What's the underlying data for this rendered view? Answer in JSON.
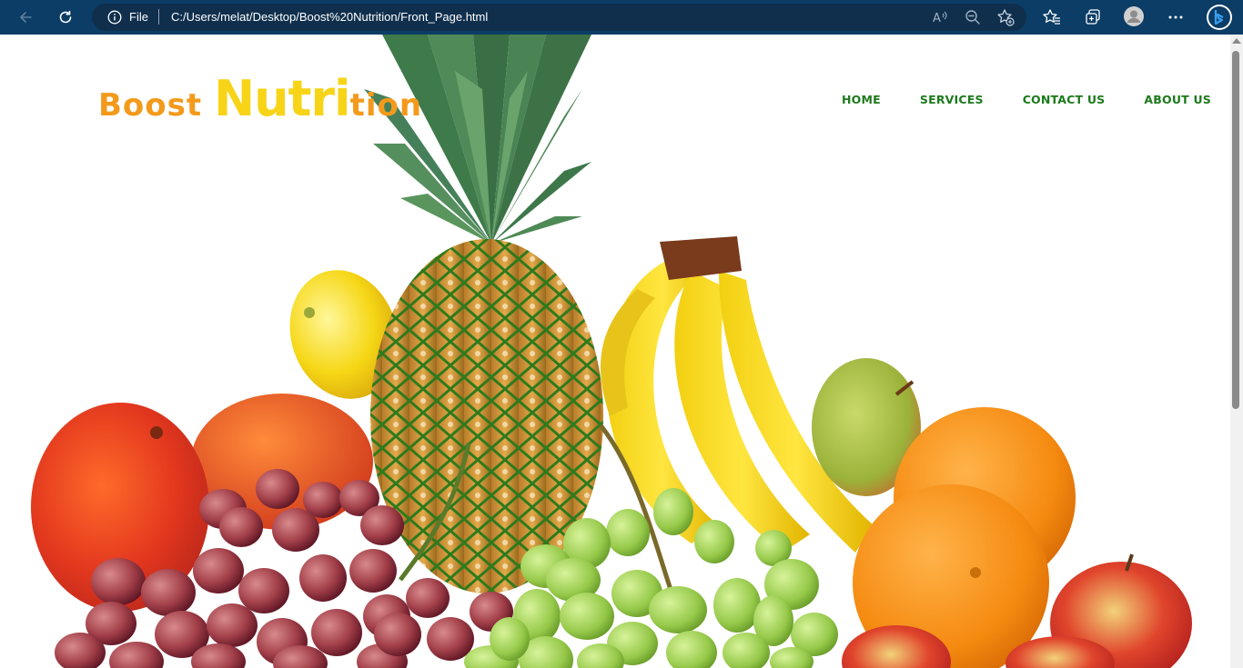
{
  "browser": {
    "address_prefix": "File",
    "url": "C:/Users/melat/Desktop/Boost%20Nutrition/Front_Page.html",
    "icons": [
      "back-icon",
      "refresh-icon",
      "info-icon",
      "read-aloud-icon",
      "zoom-out-icon",
      "add-favorite-icon",
      "favorites-icon",
      "collections-icon",
      "profile-icon",
      "more-icon",
      "bing-icon"
    ]
  },
  "site": {
    "logo": {
      "part1": "Boost ",
      "part2": "Nutri",
      "part3": "tion"
    },
    "nav": [
      "HOME",
      "SERVICES",
      "CONTACT US",
      "ABOUT US"
    ],
    "colors": {
      "logo_orange": "#f39a1c",
      "logo_yellow": "#f7d418",
      "nav_green": "#1c7a1c"
    }
  }
}
